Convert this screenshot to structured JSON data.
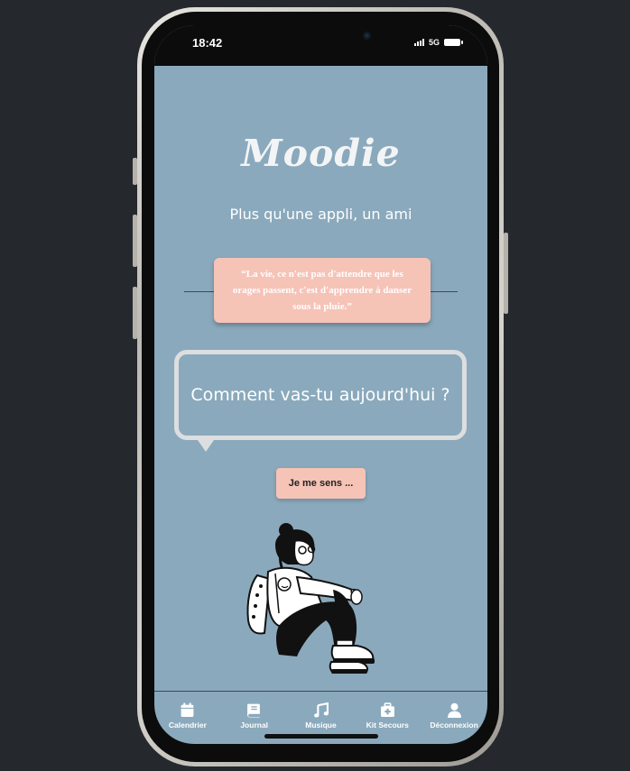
{
  "status_bar": {
    "time": "18:42",
    "network": "5G"
  },
  "app": {
    "logo": "Moodie",
    "tagline": "Plus qu'une appli, un ami"
  },
  "quote": {
    "text": "“La vie, ce n'est pas d'attendre que les orages passent, c'est d'apprendre à danser sous la pluie.”"
  },
  "prompt": {
    "question": "Comment vas-tu aujourd'hui ?"
  },
  "action": {
    "feel_button": "Je me sens ..."
  },
  "tabbar": {
    "items": [
      {
        "label": "Calendrier",
        "icon": "calendar-icon"
      },
      {
        "label": "Journal",
        "icon": "book-icon"
      },
      {
        "label": "Musique",
        "icon": "music-icon"
      },
      {
        "label": "Kit Secours",
        "icon": "first-aid-kit-icon"
      },
      {
        "label": "Déconnexion",
        "icon": "user-icon"
      }
    ]
  },
  "colors": {
    "background": "#25292e",
    "screen": "#8aa9bc",
    "accent_peach": "#f6c3b7",
    "bubble_border": "#dcdedf"
  }
}
